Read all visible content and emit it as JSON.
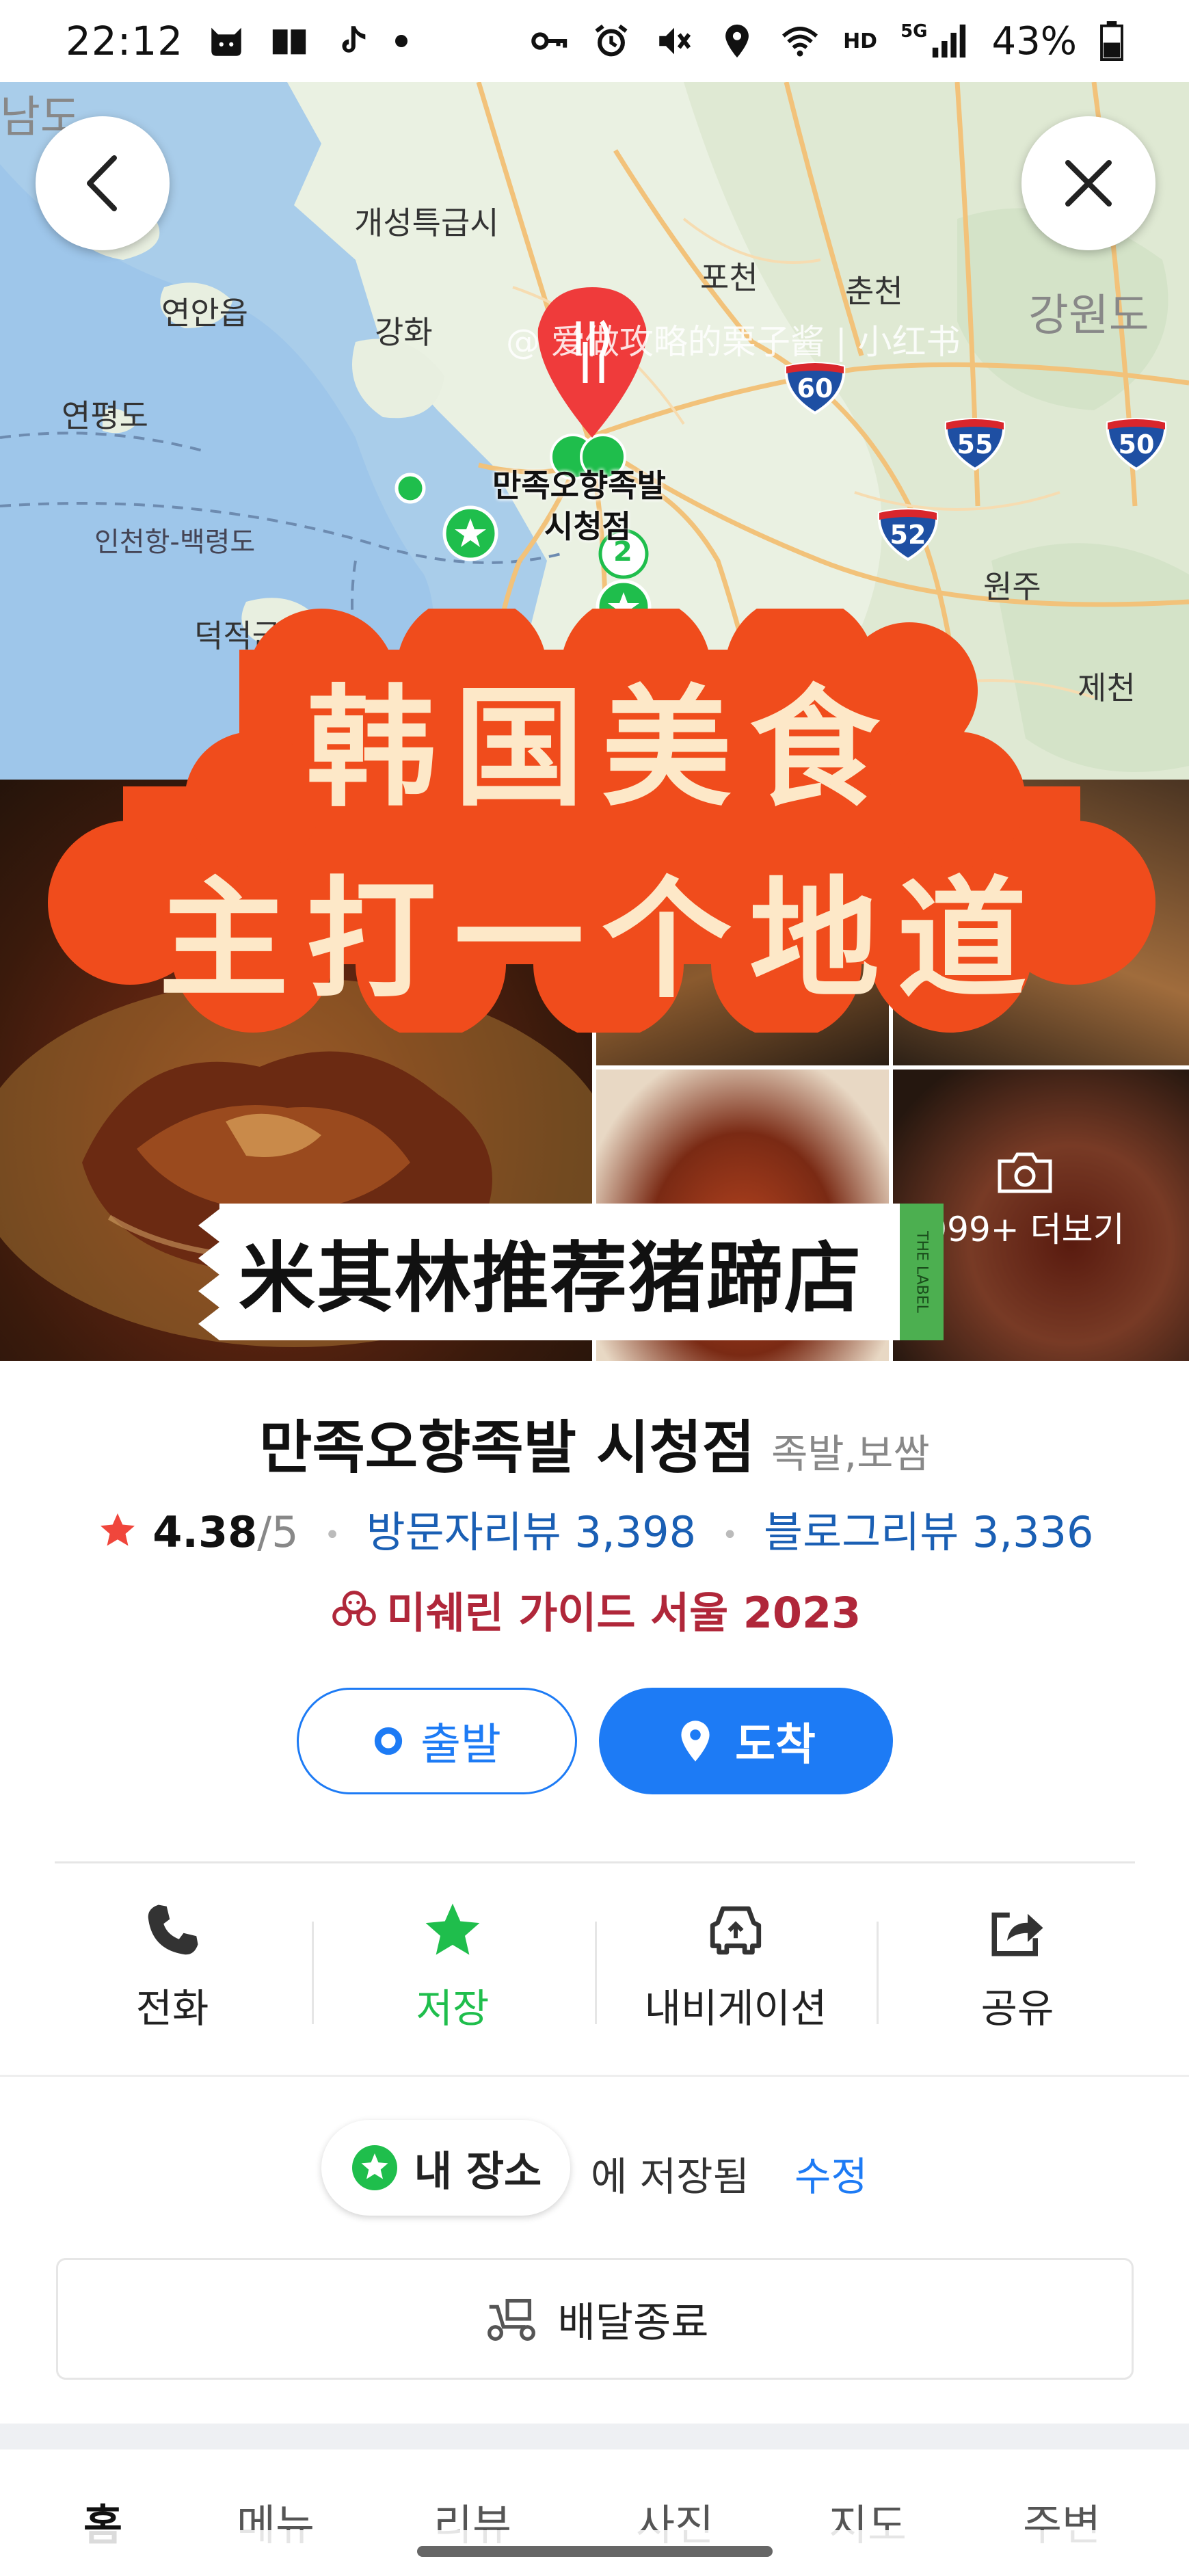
{
  "status_bar": {
    "time": "22:12",
    "battery": "43%",
    "network": "HD",
    "signal": "5G"
  },
  "map": {
    "labels": {
      "namdo": "남도",
      "gaeseong": "개성특급시",
      "yeonan": "연안읍",
      "ganghwa": "강화",
      "pocheon": "포천",
      "chuncheon": "춘천",
      "gangwon": "강원도",
      "yeonpyeong": "연평도",
      "incheon_route": "인천항-백령도",
      "deokjeok": "덕적군도",
      "wonju": "원주",
      "jecheon": "제천",
      "place_name_line1": "만족오향족발",
      "place_name_line2": "시청점"
    },
    "highways": [
      "60",
      "55",
      "50",
      "52"
    ],
    "cluster_count": "2",
    "watermark": "@ 爱做攻略的栗子酱 | 小红书",
    "colors": {
      "water": "#9ec6ea",
      "land": "#eaf1e2",
      "road": "#f2c27a",
      "marker": "#ef3b3b",
      "green": "#1fbe4c"
    }
  },
  "buttons": {
    "back_icon": "chevron-left-icon",
    "close_icon": "close-icon"
  },
  "overlay": {
    "line1": "韩国美食",
    "line2": "主打一个地道",
    "tag": "米其林推荐猪蹄店",
    "label_tab": "THE LABEL",
    "colors": {
      "banner": "#f04c1c",
      "text": "#fde8c8"
    }
  },
  "photos": {
    "more_label": "999+ 더보기"
  },
  "place": {
    "name": "만족오향족발 시청점",
    "category": "족발,보쌈",
    "rating": "4.38",
    "rating_max": "/5",
    "visitor_reviews": "방문자리뷰 3,398",
    "blog_reviews": "블로그리뷰 3,336",
    "michelin": "미쉐린 가이드 서울 2023"
  },
  "route": {
    "start_label": "출발",
    "end_label": "도착"
  },
  "actions": [
    {
      "label": "전화",
      "icon": "phone-icon"
    },
    {
      "label": "저장",
      "icon": "star-icon"
    },
    {
      "label": "내비게이션",
      "icon": "navigation-car-icon"
    },
    {
      "label": "공유",
      "icon": "share-icon"
    }
  ],
  "saved": {
    "pill_label": "내 장소",
    "text": "에 저장됨",
    "edit_label": "수정"
  },
  "delivery": {
    "label": "배달종료"
  },
  "tabs": [
    "홈",
    "메뉴",
    "리뷰",
    "사진",
    "지도",
    "주변"
  ]
}
